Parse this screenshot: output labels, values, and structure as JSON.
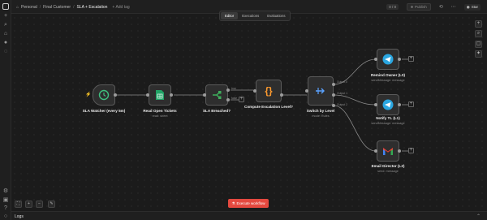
{
  "breadcrumb": {
    "project": "Personal",
    "folder": "Final Customer",
    "workflow": "SLA + Escalation",
    "add_tag": "+ Add tag"
  },
  "header": {
    "version_badge": "0 / 0",
    "publish_label": "Publish",
    "star_label": "Star"
  },
  "tabs": [
    {
      "label": "Editor",
      "active": true
    },
    {
      "label": "Executions",
      "active": false
    },
    {
      "label": "Evaluations",
      "active": false
    }
  ],
  "nodes": {
    "sla_watcher": {
      "title": "SLA Watcher (every 5m)",
      "icon": "clock-icon"
    },
    "read_tickets": {
      "title": "Read Open Tickets",
      "subtitle": "read: sheet",
      "icon": "sheets-icon"
    },
    "sla_breached": {
      "title": "SLA Breached?",
      "icon": "if-icon",
      "true_label": "true",
      "false_label": "false"
    },
    "compute_level": {
      "title": "Compute Escalation Level?",
      "icon": "code-braces-icon"
    },
    "switch_level": {
      "title": "Switch by Level",
      "subtitle": "mode: Rules",
      "icon": "switch-icon",
      "outputs": [
        "Output 0",
        "Output 1",
        "Output 2"
      ]
    },
    "remind_owner": {
      "title": "Remind Owner (L0)",
      "subtitle": "sendMessage: message",
      "icon": "telegram-icon"
    },
    "notify_tl": {
      "title": "Notify TL (L1)",
      "subtitle": "sendMessage: message",
      "icon": "telegram-icon"
    },
    "email_director": {
      "title": "Email Director (L2)",
      "subtitle": "send: message",
      "icon": "gmail-icon"
    }
  },
  "actions": {
    "execute_label": "Execute workflow"
  },
  "logs_label": "Logs",
  "colors": {
    "accent_red": "#e4493f",
    "clock_green": "#3fbf7f",
    "sheets_green": "#21a366",
    "if_green": "#3fae5c",
    "code_orange": "#ff9b2e",
    "switch_blue": "#5aa2ff",
    "telegram_blue": "#2aa6e0",
    "gmail_red": "#ea4335"
  }
}
